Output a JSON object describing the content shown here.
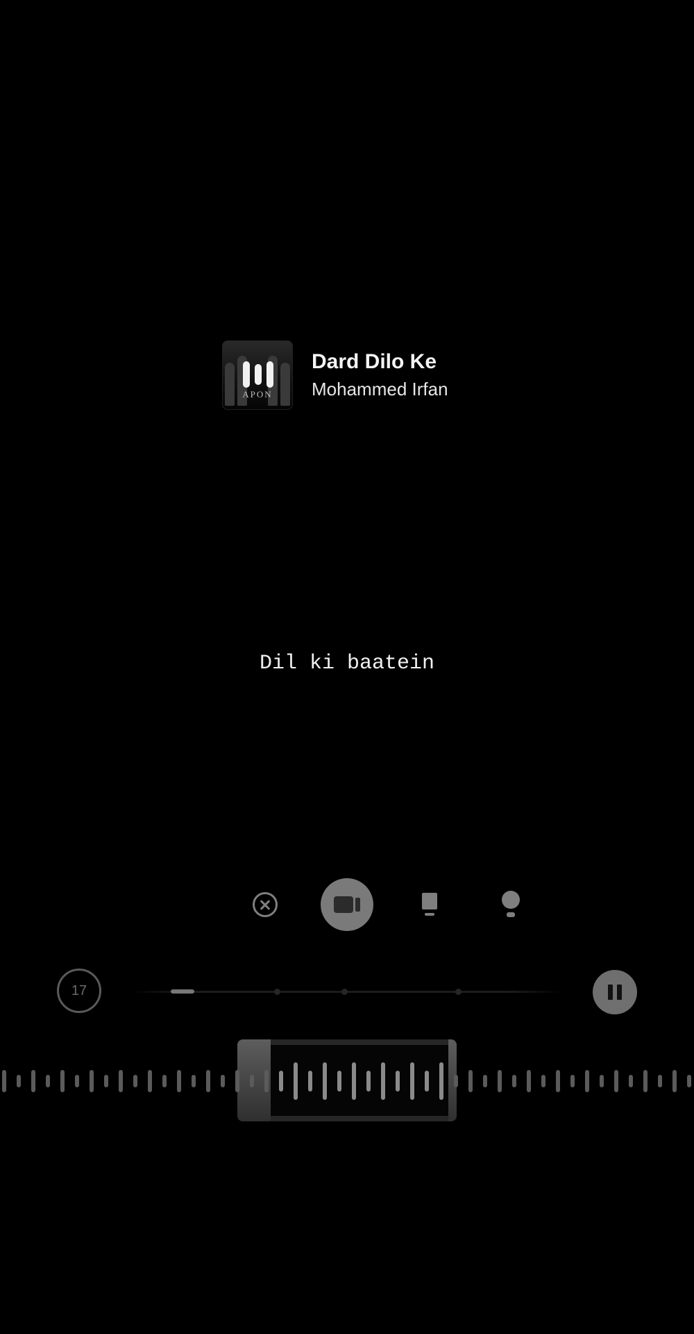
{
  "song": {
    "title": "Dard Dilo Ke",
    "artist": "Mohammed Irfan",
    "album_art_text": "APON"
  },
  "lyrics": {
    "current_line": "Dil ki baatein"
  },
  "toolbar": {
    "tools": [
      {
        "name": "close",
        "icon": "close-icon",
        "active": false
      },
      {
        "name": "video",
        "icon": "video-icon",
        "active": true
      },
      {
        "name": "card",
        "icon": "card-icon",
        "active": false
      },
      {
        "name": "bulb",
        "icon": "bulb-icon",
        "active": false
      }
    ]
  },
  "playback": {
    "counter": "17",
    "state": "playing",
    "pause_icon": "pause-icon"
  },
  "colors": {
    "background": "#000000",
    "text": "#f4f4f4",
    "muted": "#7f7f7f",
    "active_tool": "#7a7a7a"
  }
}
